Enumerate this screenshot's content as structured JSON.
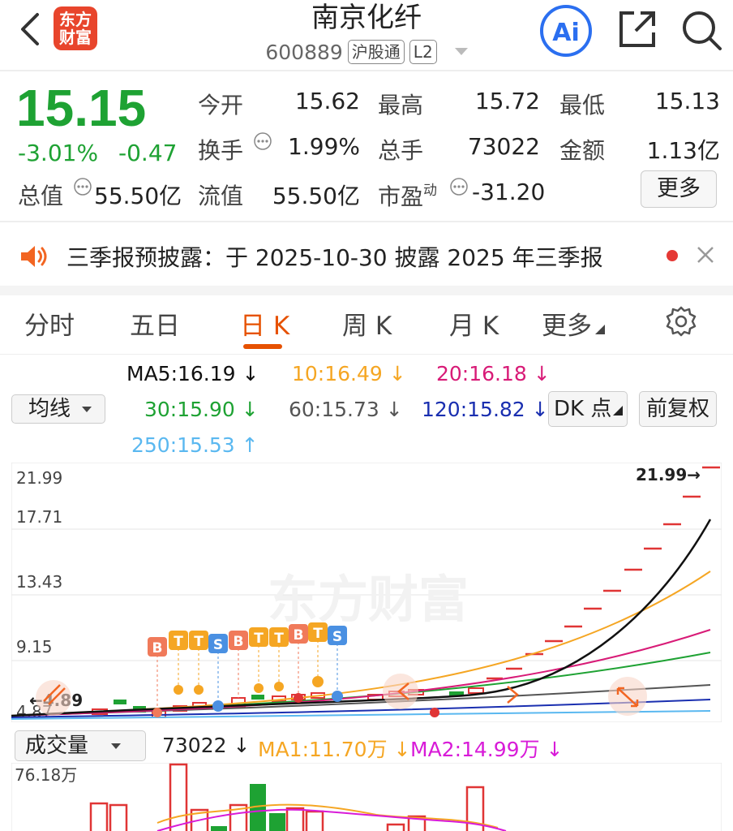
{
  "header": {
    "title": "南京化纤",
    "code": "600889",
    "tag1": "沪股通",
    "tag2": "L2",
    "logo_line1": "东方",
    "logo_line2": "财富",
    "ai_label": "Ai"
  },
  "quote": {
    "price": "15.15",
    "change_pct": "-3.01%",
    "change": "-0.47",
    "open_label": "今开",
    "open": "15.62",
    "high_label": "最高",
    "high": "15.72",
    "low_label": "最低",
    "low": "15.13",
    "turnover_label": "换手",
    "turnover": "1.99%",
    "volume_label": "总手",
    "volume": "73022",
    "amount_label": "金额",
    "amount": "1.13亿",
    "mcap_label": "总值",
    "mcap": "55.50亿",
    "float_label": "流值",
    "float_mcap": "55.50亿",
    "pe_label": "市盈",
    "pe_sup": "动",
    "pe": "-31.20",
    "more_label": "更多"
  },
  "notice": {
    "text": "三季报预披露：于 2025-10-30 披露 2025 年三季报"
  },
  "tabs": [
    "分时",
    "五日",
    "日 K",
    "周 K",
    "月 K",
    "更多"
  ],
  "ma": {
    "selector": "均线",
    "ma5": "MA5:16.19 ↓",
    "ma10": "10:16.49 ↓",
    "ma20": "20:16.18 ↓",
    "ma30": "30:15.90 ↓",
    "ma60": "60:15.73 ↓",
    "ma120": "120:15.82 ↓",
    "ma250": "250:15.53 ↑",
    "dk_label": "DK 点",
    "adj_label": "前复权"
  },
  "colors": {
    "ma5": "#111111",
    "ma10": "#f5a623",
    "ma20": "#d81b77",
    "ma30": "#1ea233",
    "ma60": "#555555",
    "ma120": "#1a2fb0",
    "ma250": "#5ab8f0",
    "up": "#e03535",
    "down": "#1ea233"
  },
  "chart": {
    "y_labels": [
      "21.99",
      "17.71",
      "13.43",
      "9.15",
      "4.87"
    ],
    "max_marker": "21.99→",
    "min_marker": "←4.89",
    "watermark": "东方财富",
    "signals": [
      "B",
      "T",
      "T",
      "S",
      "B",
      "T",
      "T",
      "B",
      "T",
      "S"
    ]
  },
  "volume": {
    "selector": "成交量",
    "value": "73022 ↓",
    "ma1": "MA1:11.70万 ↓",
    "ma2": "MA2:14.99万 ↓",
    "y_label": "76.18万"
  },
  "icons": [
    "back-icon",
    "ai-icon",
    "share-icon",
    "search-icon",
    "speaker-icon",
    "close-icon",
    "gear-icon",
    "info-icon"
  ]
}
